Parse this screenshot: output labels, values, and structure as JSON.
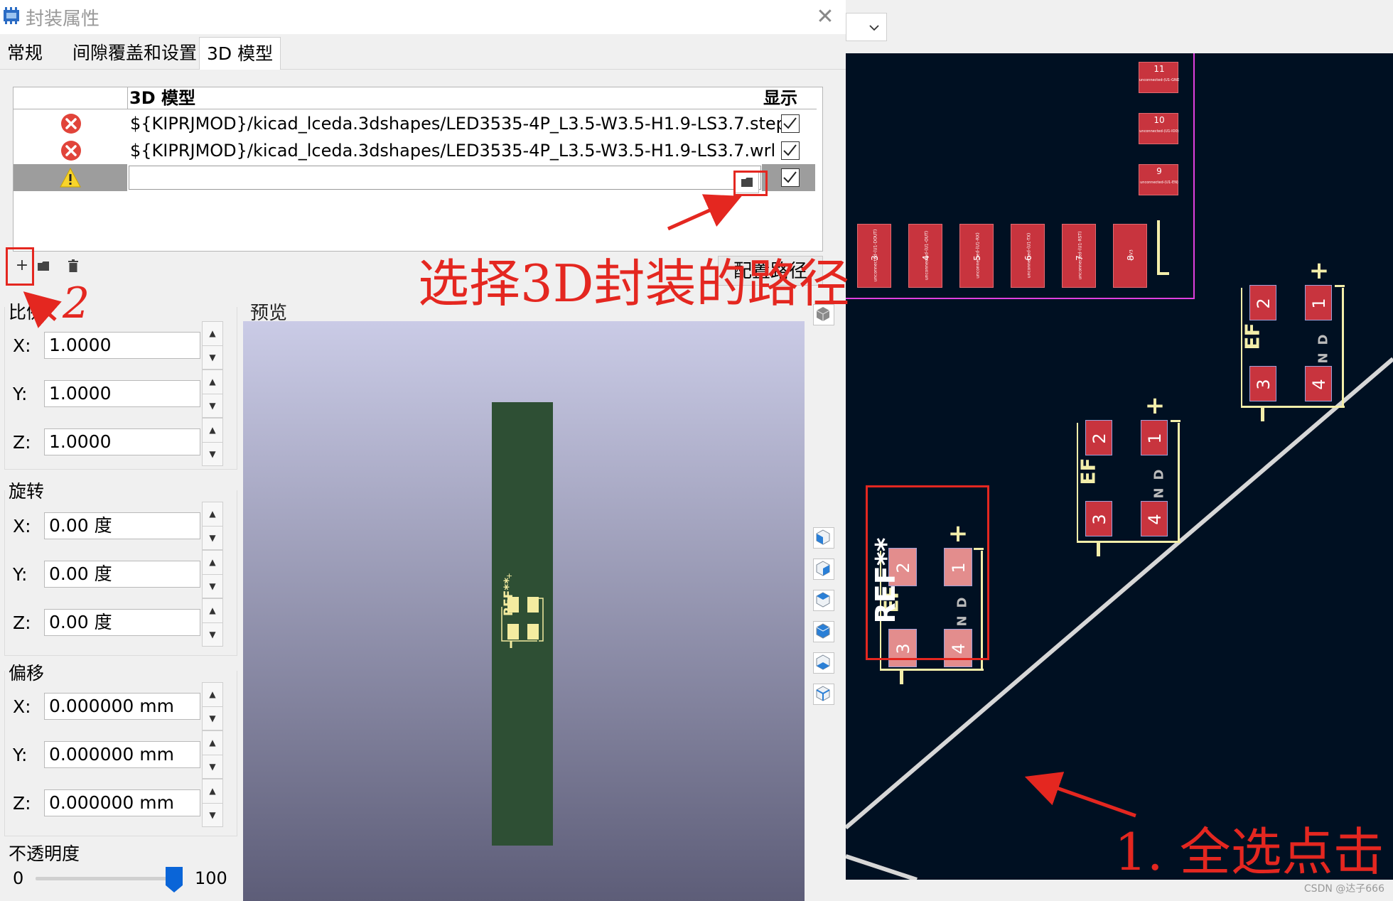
{
  "dialog": {
    "title": "封装属性",
    "close_glyph": "✕",
    "tabs": [
      {
        "label": "常规"
      },
      {
        "label": "间隙覆盖和设置"
      },
      {
        "label": "3D 模型"
      }
    ],
    "table": {
      "col_model": "3D 模型",
      "col_show": "显示",
      "rows": [
        {
          "path": "${KIPRJMOD}/kicad_lceda.3dshapes/LED3535-4P_L3.5-W3.5-H1.9-LS3.7.step",
          "status": "error-icon"
        },
        {
          "path": "${KIPRJMOD}/kicad_lceda.3dshapes/LED3535-4P_L3.5-W3.5-H1.9-LS3.7.wrl",
          "status": "error-icon"
        },
        {
          "path": "",
          "status": "warning-icon"
        }
      ]
    },
    "toolbar": {
      "add": "+",
      "config_path_label": "配置路径"
    },
    "scale": {
      "title": "比例",
      "x_label": "X:",
      "x": "1.0000",
      "y_label": "Y:",
      "y": "1.0000",
      "z_label": "Z:",
      "z": "1.0000"
    },
    "rotation": {
      "title": "旋转",
      "x_label": "X:",
      "x": "0.00 度",
      "y_label": "Y:",
      "y": "0.00 度",
      "z_label": "Z:",
      "z": "0.00 度"
    },
    "offset": {
      "title": "偏移",
      "x_label": "X:",
      "x": "0.000000 mm",
      "y_label": "Y:",
      "y": "0.000000 mm",
      "z_label": "Z:",
      "z": "0.000000 mm"
    },
    "opacity": {
      "title": "不透明度",
      "min": "0",
      "max": "100",
      "value": 100
    },
    "preview": {
      "label": "预览",
      "ref_text": "REF**",
      "plus": "+"
    }
  },
  "pcb": {
    "ref_text": "REF**",
    "pads_top_row": [
      {
        "num": "3",
        "net": "unconnected-(U1-DOUT)"
      },
      {
        "num": "4",
        "net": "unconnected-(U1-OUT)"
      },
      {
        "num": "5",
        "net": "unconnected-(U1-RX)"
      },
      {
        "num": "6",
        "net": "unconnected-(U1-TX)"
      },
      {
        "num": "7",
        "net": "unconnected-(U1-RST)"
      },
      {
        "num": "8",
        "net": "+3V3"
      }
    ],
    "pads_right_col": [
      {
        "num": "11",
        "net": "unconnected-(U1-GND)"
      },
      {
        "num": "10",
        "net": "unconnected-(U1-IO0)"
      },
      {
        "num": "9",
        "net": "unconnected-(U1-EN)"
      }
    ],
    "led_pads": [
      "1",
      "2",
      "3",
      "4"
    ],
    "silk_text_a": "EF",
    "silk_text_b": "D",
    "silk_text_c": "N",
    "watermark": "CSDN @达子666"
  },
  "annotations": {
    "select_path": "选择3D封装的路径",
    "step_two": "2",
    "step_one": "1. 全选点击"
  },
  "colors": {
    "annotation_red": "#e42720",
    "pcb_bg": "#001022",
    "pad_red": "#c8343e",
    "pad_pink": "#e38d8d",
    "silk_yellow": "#f3eeaa",
    "edge_gray": "#d7d7d7",
    "courtyard_magenta": "#e040e0",
    "board_green": "#2e4f34"
  }
}
